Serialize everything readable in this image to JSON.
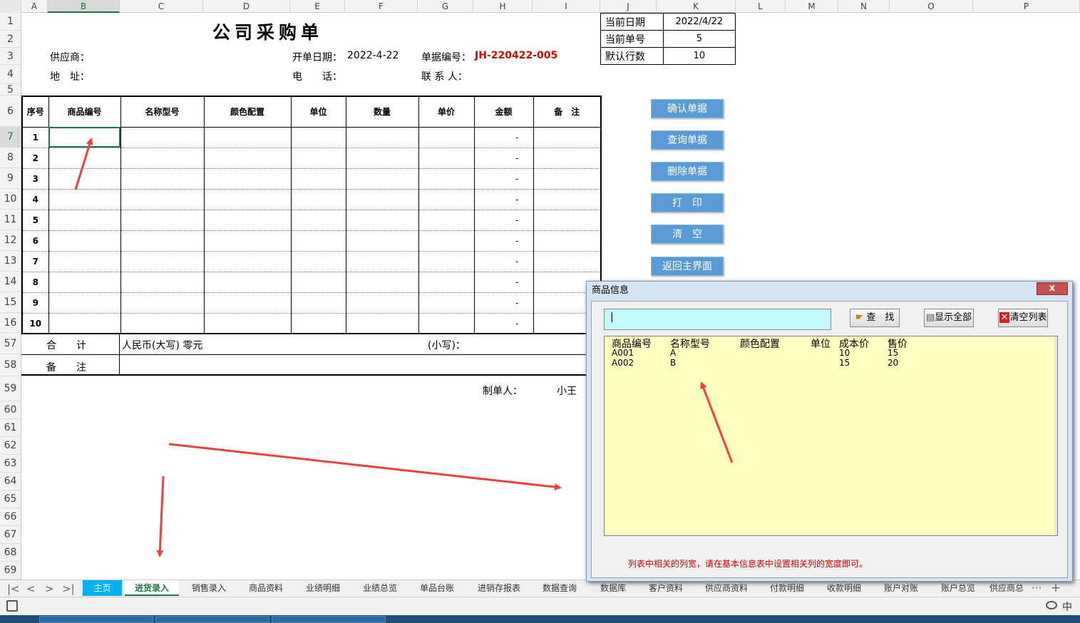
{
  "columns": [
    "A",
    "B",
    "C",
    "D",
    "E",
    "F",
    "G",
    "H",
    "I",
    "J",
    "K",
    "L",
    "M",
    "N",
    "O",
    "P"
  ],
  "rows": [
    "1",
    "2",
    "3",
    "4",
    "5",
    "6",
    "7",
    "8",
    "9",
    "10",
    "11",
    "12",
    "13",
    "14",
    "15",
    "16",
    "57",
    "58",
    "59",
    "60",
    "61",
    "62",
    "63",
    "64",
    "65",
    "66",
    "67",
    "68",
    "69"
  ],
  "sheet": {
    "title": "公司采购单",
    "supplier_label": "供应商：",
    "address_label": "地　址：",
    "date_label": "开单日期：",
    "date_value": "2022-4-22",
    "phone_label": "电　　话：",
    "docno_label": "单据编号：",
    "docno_value": "JH-220422-005",
    "contact_label": "联 系 人：",
    "info": [
      {
        "label": "当前日期",
        "value": "2022/4/22"
      },
      {
        "label": "当前单号",
        "value": "5"
      },
      {
        "label": "默认行数",
        "value": "10"
      }
    ],
    "headers": [
      "序号",
      "商品编号",
      "名称型号",
      "颜色配置",
      "单位",
      "数量",
      "单价",
      "金额",
      "备　注"
    ],
    "line_numbers": [
      "1",
      "2",
      "3",
      "4",
      "5",
      "6",
      "7",
      "8",
      "9",
      "10"
    ],
    "amount_placeholder": "-",
    "total_label": "合　　计",
    "total_upper": "人民币(大写) 零元",
    "total_lower_label": "(小写)：",
    "remark_label": "备　　注",
    "maker_label": "制单人：",
    "maker_value": "小王"
  },
  "buttons": {
    "confirm": "确认单据",
    "query": "查询单据",
    "delete": "删除单据",
    "print": "打　印",
    "clear": "清　空",
    "back": "返回主界面"
  },
  "tabs": [
    "主页",
    "进货录入",
    "销售录入",
    "商品资料",
    "业绩明细",
    "业绩总览",
    "单品台账",
    "进销存报表",
    "数据查询",
    "数据库",
    "客户资料",
    "供应商资料",
    "付款明细",
    "收款明细",
    "账户对账",
    "账户总览",
    "供应商总"
  ],
  "tab_nav": {
    "first": "|<",
    "prev": "<",
    "next": ">",
    "last": ">|",
    "more": "···",
    "add": "+"
  },
  "dialog": {
    "title": "商品信息",
    "close": "x",
    "search_value": "|",
    "find_label": "查　找",
    "show_all_label": "显示全部",
    "clear_list_label": "清空列表",
    "list_headers": [
      "商品编号",
      "名称型号",
      "颜色配置",
      "单位",
      "成本价",
      "售价"
    ],
    "list_rows": [
      {
        "code": "A001",
        "name": "A",
        "cost": "10",
        "price": "15"
      },
      {
        "code": "A002",
        "name": "B",
        "cost": "15",
        "price": "20"
      }
    ],
    "note": "列表中相关的列宽，请在基本信息表中设置相关列的宽度即可。"
  },
  "status": {
    "input_method": "中"
  },
  "colors": {
    "excel_green": "#217346",
    "button_blue": "#5b9bd5",
    "search_bg": "#c2fbfc",
    "list_bg": "#ffffbf",
    "home_tab": "#00b0f0",
    "arrow_red": "#f04040"
  }
}
